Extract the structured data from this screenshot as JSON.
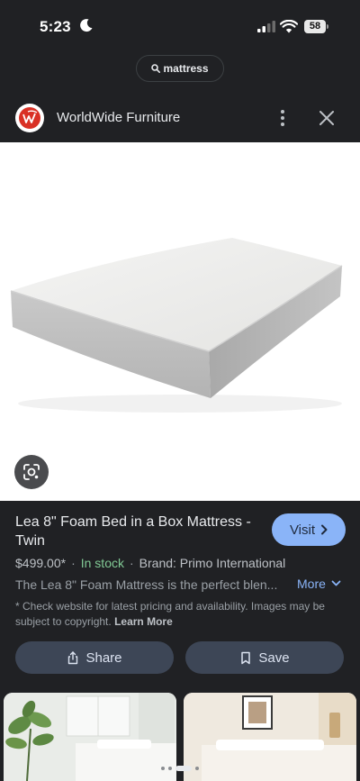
{
  "status_bar": {
    "time": "5:23",
    "battery": "58"
  },
  "search": {
    "query": "mattress"
  },
  "site": {
    "name": "WorldWide Furniture"
  },
  "product": {
    "title": "Lea 8\" Foam Bed in a Box Mattress - Twin",
    "visit_label": "Visit",
    "price": "$499.00*",
    "stock": "In stock",
    "brand": "Brand: Primo International",
    "description": "The Lea 8\" Foam Mattress is the perfect blen...",
    "more_label": "More",
    "disclaimer": "* Check website for latest pricing and availability. Images may be subject to copyright.",
    "learn_more": "Learn More"
  },
  "actions": {
    "share_label": "Share",
    "save_label": "Save"
  },
  "icons": {
    "moon": "moon-icon",
    "signal": "cellular-signal-icon",
    "wifi": "wifi-icon",
    "battery": "battery-icon",
    "search": "search-icon",
    "logo": "site-logo",
    "more": "more-vert-icon",
    "close": "close-icon",
    "lens": "lens-icon",
    "chevron_right": "chevron-right-icon",
    "chevron_down": "chevron-down-icon",
    "share": "share-icon",
    "bookmark": "bookmark-icon"
  },
  "colors": {
    "background": "#202124",
    "accent": "#8ab4f8",
    "in_stock": "#81c995",
    "action_button": "#3d4656",
    "logo_red": "#d93025"
  },
  "carousel": {
    "page_count": 4,
    "active_index": 2
  }
}
